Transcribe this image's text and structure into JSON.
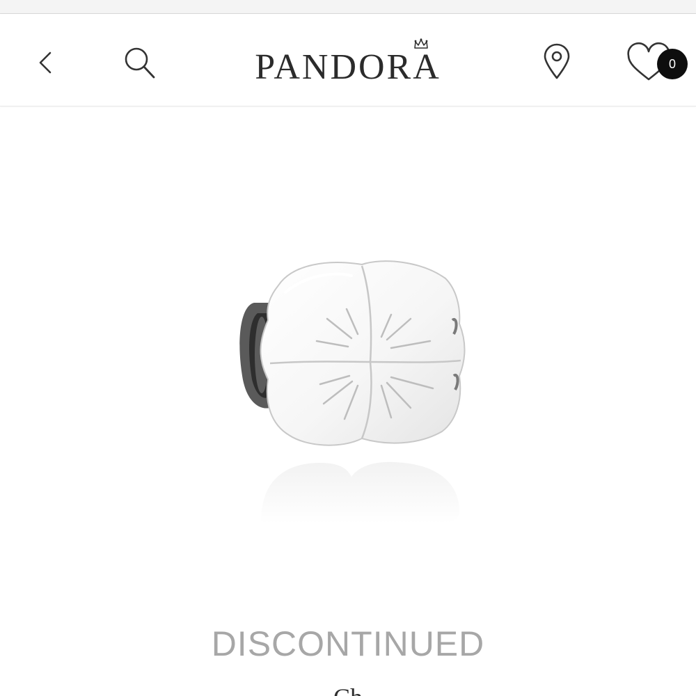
{
  "header": {
    "brand": "PANDORA",
    "back_icon": "chevron-left-icon",
    "search_icon": "search-icon",
    "location_icon": "map-pin-icon",
    "wishlist_icon": "heart-icon",
    "wishlist_count": "0"
  },
  "product": {
    "image_icon": "clover-charm-image",
    "status": "DISCONTINUED",
    "name": "Ch"
  },
  "colors": {
    "text_dark": "#2b2b2b",
    "badge_bg": "#0e0e0e",
    "status_gray": "#a7a7a7"
  }
}
